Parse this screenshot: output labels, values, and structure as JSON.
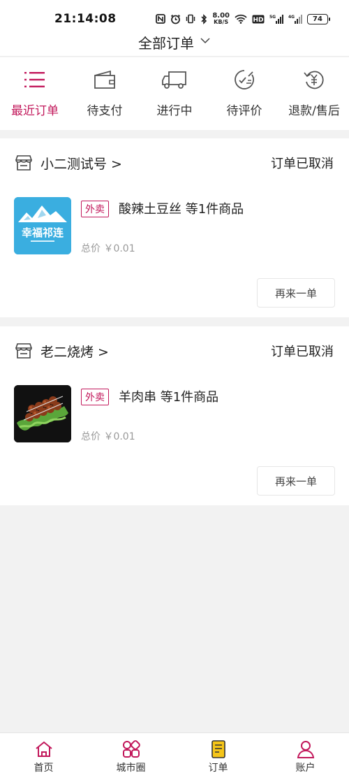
{
  "status_bar": {
    "time": "21:14:08",
    "net_speed_value": "8.00",
    "net_speed_unit": "KB/S",
    "battery": "74"
  },
  "header": {
    "title": "全部订单"
  },
  "tabs": [
    {
      "label": "最近订单",
      "icon": "list-icon",
      "active": true
    },
    {
      "label": "待支付",
      "icon": "wallet-icon",
      "active": false
    },
    {
      "label": "进行中",
      "icon": "truck-icon",
      "active": false
    },
    {
      "label": "待评价",
      "icon": "review-icon",
      "active": false
    },
    {
      "label": "退款/售后",
      "icon": "refund-icon",
      "active": false
    }
  ],
  "orders": [
    {
      "shop": "小二测试号 >",
      "status": "订单已取消",
      "thumbnail_text": "幸福祁连",
      "tag": "外卖",
      "title": "酸辣土豆丝 等1件商品",
      "price": "总价 ￥0.01",
      "action": "再来一单"
    },
    {
      "shop": "老二烧烤 >",
      "status": "订单已取消",
      "tag": "外卖",
      "title": "羊肉串 等1件商品",
      "price": "总价 ￥0.01",
      "action": "再来一单"
    }
  ],
  "bottom_nav": [
    {
      "label": "首页",
      "icon": "home-icon"
    },
    {
      "label": "城市圈",
      "icon": "city-circle-icon"
    },
    {
      "label": "订单",
      "icon": "orders-icon"
    },
    {
      "label": "账户",
      "icon": "account-icon"
    }
  ],
  "colors": {
    "accent": "#c2185b",
    "background": "#f2f2f2",
    "orders_icon_fill": "#f5c518"
  }
}
